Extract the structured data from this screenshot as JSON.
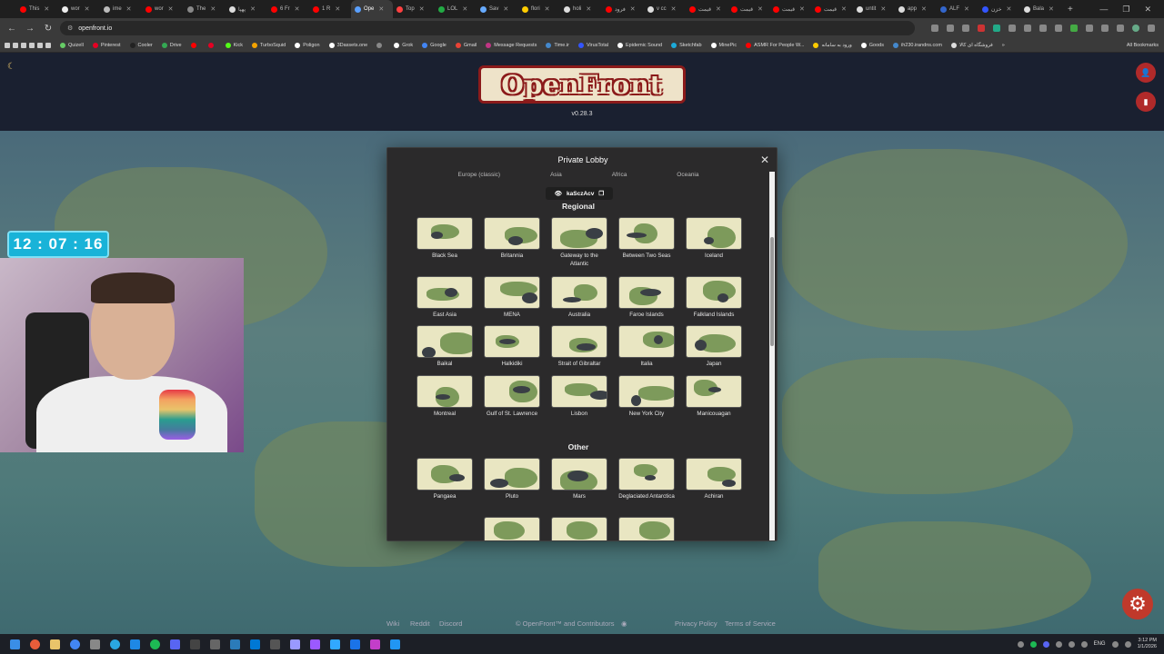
{
  "browser": {
    "tabs": [
      {
        "label": "This",
        "color": "#ff0000"
      },
      {
        "label": "wor",
        "color": "#eeeeee"
      },
      {
        "label": "ime",
        "color": "#bbbbbb"
      },
      {
        "label": "wor",
        "color": "#ff0000"
      },
      {
        "label": "The",
        "color": "#888888"
      },
      {
        "label": "پهپا",
        "color": "#dddddd"
      },
      {
        "label": "6 Fr",
        "color": "#ff0000"
      },
      {
        "label": "1 R",
        "color": "#ff0000"
      },
      {
        "label": "Ope",
        "color": "#5aa0ff",
        "active": true
      },
      {
        "label": "Top",
        "color": "#ff4040"
      },
      {
        "label": "LOL",
        "color": "#22aa44"
      },
      {
        "label": "Sav",
        "color": "#66aaff"
      },
      {
        "label": "flori",
        "color": "#ffcc00"
      },
      {
        "label": "holi",
        "color": "#dddddd"
      },
      {
        "label": "فرود",
        "color": "#ff0000"
      },
      {
        "label": "v cc",
        "color": "#dddddd"
      },
      {
        "label": "قیمت",
        "color": "#ff0000"
      },
      {
        "label": "قیمت",
        "color": "#ff0000"
      },
      {
        "label": "قیمت",
        "color": "#ff0000"
      },
      {
        "label": "قیمت",
        "color": "#ff0000"
      },
      {
        "label": "untit",
        "color": "#dddddd"
      },
      {
        "label": "app",
        "color": "#dddddd"
      },
      {
        "label": "ALF",
        "color": "#3366cc"
      },
      {
        "label": "خزن",
        "color": "#3355ff"
      },
      {
        "label": "Bala",
        "color": "#dddddd"
      }
    ],
    "new_tab": "+",
    "url": "openfront.io",
    "window_controls": [
      "—",
      "❐",
      "✕"
    ],
    "bookmarks": [
      {
        "label": "Quizell",
        "color": "#66cc66"
      },
      {
        "label": "Pinterest",
        "color": "#e60023"
      },
      {
        "label": "Cooler",
        "color": "#222222"
      },
      {
        "label": "Drive",
        "color": "#34a853"
      },
      {
        "label": "",
        "color": "#ff0000"
      },
      {
        "label": "",
        "color": "#e60023"
      },
      {
        "label": "Kick",
        "color": "#53fc18"
      },
      {
        "label": "TurboSquid",
        "color": "#f4a300"
      },
      {
        "label": "Poligon",
        "color": "#ffffff"
      },
      {
        "label": "3Dassets.one",
        "color": "#ffffff"
      },
      {
        "label": "",
        "color": "#888888"
      },
      {
        "label": "Grok",
        "color": "#ffffff"
      },
      {
        "label": "Google",
        "color": "#4285f4"
      },
      {
        "label": "Gmail",
        "color": "#ea4335"
      },
      {
        "label": "Message Requests",
        "color": "#c13584"
      },
      {
        "label": "Time.ir",
        "color": "#4488cc"
      },
      {
        "label": "VirusTotal",
        "color": "#3355ff"
      },
      {
        "label": "Epidemic Sound",
        "color": "#ffffff"
      },
      {
        "label": "Sketchfab",
        "color": "#1caad9"
      },
      {
        "label": "MinePic",
        "color": "#ffffff"
      },
      {
        "label": "ASMR For People W...",
        "color": "#ff0000"
      },
      {
        "label": "ورود به سامانه",
        "color": "#ffcc00"
      },
      {
        "label": "Goods",
        "color": "#ffffff"
      },
      {
        "label": "ih230.irandns.com",
        "color": "#4488cc"
      },
      {
        "label": "فروشگاه ای کالا",
        "color": "#dddddd"
      }
    ],
    "all_bookmarks": "All Bookmarks"
  },
  "header": {
    "logo_text": "OpenFront",
    "version": "v0.28.3"
  },
  "overlay": {
    "timer": "12 : 07 : 16"
  },
  "modal": {
    "title": "Private Lobby",
    "close": "✕",
    "continents": [
      "Europe (classic)",
      "Asia",
      "Africa",
      "Oceania"
    ],
    "lobby_code": "kaSczAcv",
    "regional_title": "Regional",
    "other_title": "Other",
    "regional_maps": [
      "Black Sea",
      "Britannia",
      "Gateway to the Atlantic",
      "Between Two Seas",
      "Iceland",
      "East Asia",
      "MENA",
      "Australia",
      "Faroe Islands",
      "Falkland Islands",
      "Baikal",
      "Halkidiki",
      "Strait of Gibraltar",
      "Italia",
      "Japan",
      "Montreal",
      "Gulf of St. Lawrence",
      "Lisbon",
      "New York City",
      "Manicouagan"
    ],
    "other_maps": [
      "Pangaea",
      "Pluto",
      "Mars",
      "Deglaciated Antarctica",
      "Achiran"
    ]
  },
  "footer": {
    "wiki": "Wiki",
    "reddit": "Reddit",
    "discord": "Discord",
    "copyright": "© OpenFront™ and Contributors",
    "privacy": "Privacy Policy",
    "terms": "Terms of Service"
  },
  "taskbar": {
    "language": "ENG",
    "time": "3:12 PM",
    "date": "1/1/2026"
  }
}
